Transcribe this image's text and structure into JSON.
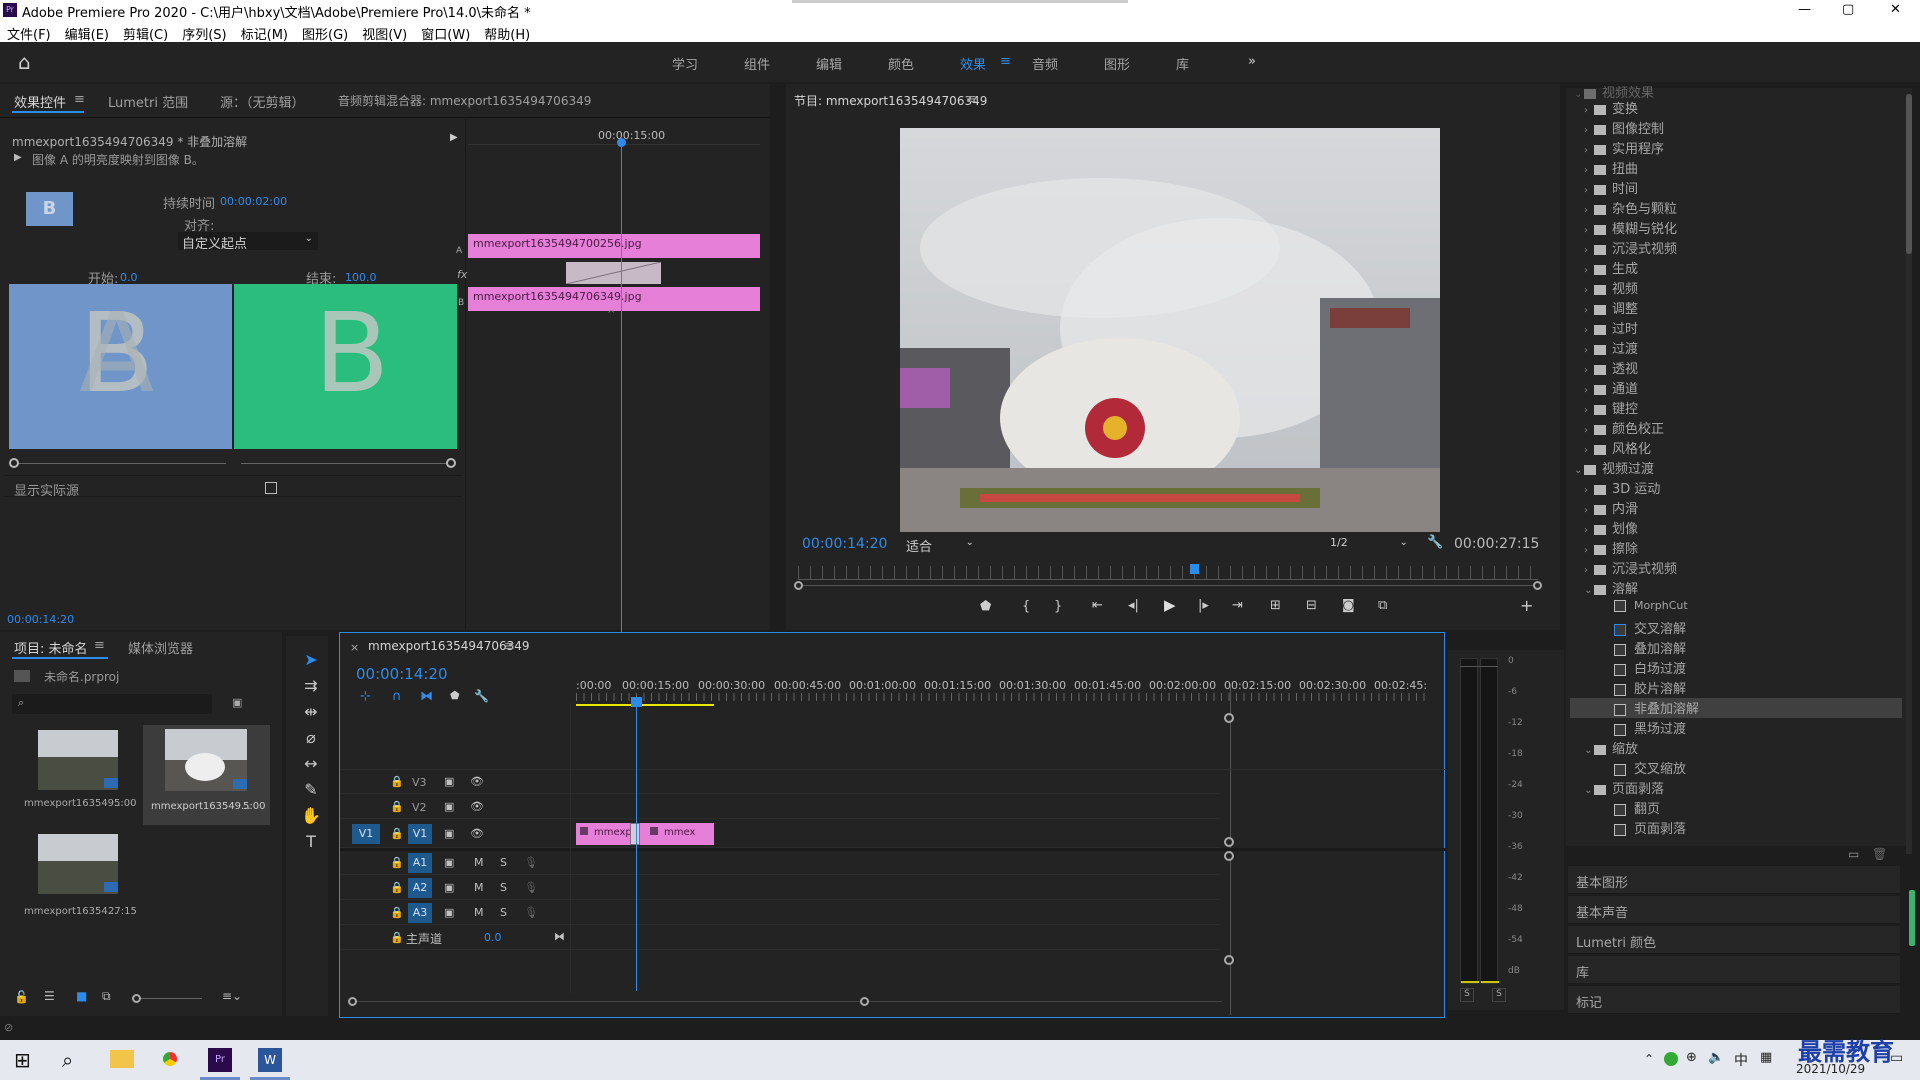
{
  "titlebar": {
    "title": "Adobe Premiere Pro 2020 - C:\\用户\\hbxy\\文档\\Adobe\\Premiere Pro\\14.0\\未命名 *",
    "logo": "Pr",
    "min": "—",
    "max": "▢",
    "close": "✕"
  },
  "menu": [
    "文件(F)",
    "编辑(E)",
    "剪辑(C)",
    "序列(S)",
    "标记(M)",
    "图形(G)",
    "视图(V)",
    "窗口(W)",
    "帮助(H)"
  ],
  "workspaces": {
    "home": "⌂",
    "items": [
      "学习",
      "组件",
      "编辑",
      "颜色",
      "效果",
      "音频",
      "图形",
      "库"
    ],
    "active": "效果",
    "more": "»"
  },
  "effect_controls": {
    "tabs": [
      "效果控件",
      "Lumetri 范围",
      "源：（无剪辑）",
      "音频剪辑混合器: mmexport1635494706349"
    ],
    "clip_header": "mmexport1635494706349 * 非叠加溶解",
    "description": "图像 A 的明亮度映射到图像 B。",
    "duration_label": "持续时间",
    "duration_value": "00:00:02:00",
    "align_label": "对齐:",
    "align_value": "自定义起点",
    "start_label": "开始:",
    "start_value": "0.0",
    "end_label": "结束:",
    "end_value": "100.0",
    "preview_a_letter": "B",
    "preview_b_letter": "B",
    "show_actual": "显示实际源",
    "timecode": "00:00:14:20",
    "mini_time": "00:00:15:00",
    "clip_a": "mmexport1635494700256.jpg",
    "clip_b": "mmexport1635494706349.jpg",
    "label_a": "A",
    "label_b": "B",
    "fx": "fx"
  },
  "program": {
    "title": "节目: mmexport1635494706349",
    "timecode": "00:00:14:20",
    "fit": "适合",
    "quality": "1/2",
    "duration": "00:00:27:15",
    "colors": {
      "sky": "#c9ccd0",
      "ground": "#7a7370"
    }
  },
  "effects_tree": {
    "top": "视频效果",
    "video_effects": [
      "变换",
      "图像控制",
      "实用程序",
      "扭曲",
      "时间",
      "杂色与颗粒",
      "模糊与锐化",
      "沉浸式视频",
      "生成",
      "视频",
      "调整",
      "过时",
      "过渡",
      "透视",
      "通道",
      "键控",
      "颜色校正",
      "风格化"
    ],
    "video_transitions_label": "视频过渡",
    "video_transitions": [
      "3D 运动",
      "内滑",
      "划像",
      "擦除",
      "沉浸式视频"
    ],
    "dissolve_label": "溶解",
    "dissolve_items": [
      "MorphCut",
      "交叉溶解",
      "叠加溶解",
      "白场过渡",
      "胶片溶解",
      "非叠加溶解",
      "黑场过渡"
    ],
    "dissolve_selected": "非叠加溶解",
    "zoom_label": "缩放",
    "zoom_items": [
      "交叉缩放"
    ],
    "page_label": "页面剥落",
    "page_items": [
      "翻页",
      "页面剥落"
    ]
  },
  "right_panels": [
    "基本图形",
    "基本声音",
    "Lumetri 颜色",
    "库",
    "标记"
  ],
  "project": {
    "tabs": [
      "项目: 未命名",
      "媒体浏览器"
    ],
    "file": "未命名.prproj",
    "search_placeholder": "",
    "items": [
      {
        "name": "mmexport163549...",
        "dur": "5:00"
      },
      {
        "name": "mmexport163549...",
        "dur": "5:00"
      },
      {
        "name": "mmexport16354...",
        "dur": "27:15"
      }
    ]
  },
  "timeline": {
    "title": "mmexport1635494706349",
    "timecode": "00:00:14:20",
    "ruler": [
      ":00:00",
      "00:00:15:00",
      "00:00:30:00",
      "00:00:45:00",
      "00:01:00:00",
      "00:01:15:00",
      "00:01:30:00",
      "00:01:45:00",
      "00:02:00:00",
      "00:02:15:00",
      "00:02:30:00",
      "00:02:45:"
    ],
    "tracks": [
      "V3",
      "V2",
      "V1",
      "A1",
      "A2",
      "A3"
    ],
    "master": "主声道",
    "master_value": "0.0",
    "source_v1": "V1",
    "clip1": "mmexpo",
    "clip2": "mmex",
    "m": "M",
    "s": "S"
  },
  "meter": {
    "ticks": [
      "0",
      "-6",
      "-12",
      "-18",
      "-24",
      "-30",
      "-36",
      "-42",
      "-48",
      "-54",
      "dB"
    ],
    "s1": "S",
    "s2": "S"
  },
  "taskbar": {
    "ime": "中",
    "date": "2021/10/29",
    "watermark": "最需教育"
  }
}
